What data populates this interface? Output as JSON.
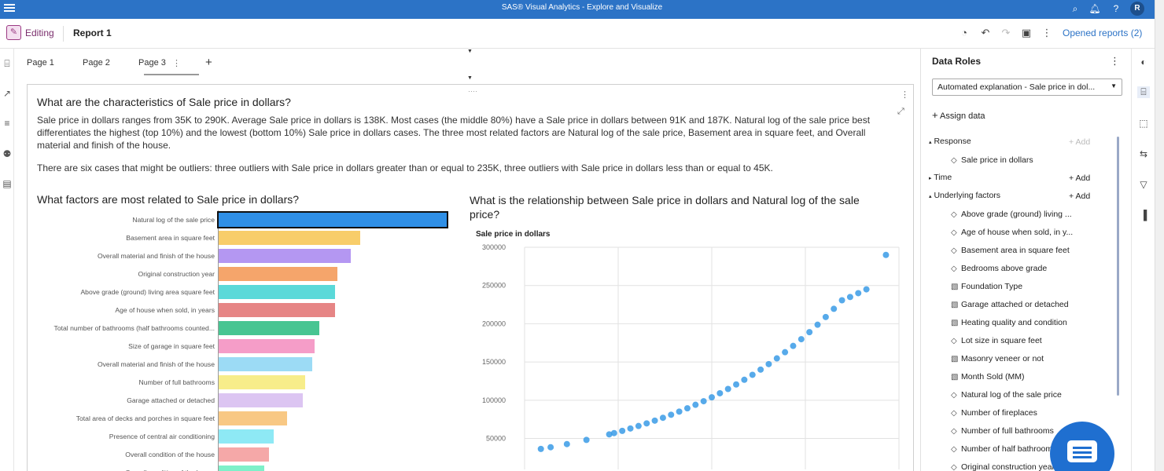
{
  "app": {
    "title": "SAS® Visual Analytics - Explore and Visualize",
    "avatar": "R"
  },
  "toolbar": {
    "mode": "Editing",
    "report_name": "Report 1",
    "opened_reports": "Opened reports (2)"
  },
  "tabs": [
    "Page 1",
    "Page 2",
    "Page 3"
  ],
  "content": {
    "question1": "What are the characteristics of Sale price in dollars?",
    "paragraph1": "Sale price in dollars ranges from 35K to 290K. Average Sale price in dollars is 138K. Most cases (the middle 80%) have a Sale price in dollars between 91K and 187K. Natural log of the sale price best differentiates the highest (top 10%) and the lowest (bottom 10%) Sale price in dollars cases. The three most related factors are Natural log of the sale price, Basement area in square feet, and Overall material and finish of the house.",
    "paragraph2": "There are six cases that might be outliers: three outliers with Sale price in dollars greater than or equal to 235K, three outliers with Sale price in dollars less than or equal to 45K.",
    "question2": "What factors are most related to Sale price in dollars?",
    "question3": "What is the relationship between Sale price in dollars and Natural log of the sale price?"
  },
  "chart_data": [
    {
      "type": "bar",
      "orientation": "horizontal",
      "title": "What factors are most related to Sale price in dollars?",
      "categories": [
        "Natural log of the sale price",
        "Basement area in square feet",
        "Overall material and finish of the house",
        "Original construction year",
        "Above grade (ground) living area square feet",
        "Age of house when sold, in years",
        "Total number of bathrooms (half bathrooms counted...",
        "Size of garage in square feet",
        "Overall material and finish of the house",
        "Number of full bathrooms",
        "Garage attached or detached",
        "Total area of decks and porches in square feet",
        "Presence of central air conditioning",
        "Overall condition of the house",
        "Overall condition of the house"
      ],
      "values": [
        1.0,
        0.62,
        0.58,
        0.52,
        0.51,
        0.51,
        0.44,
        0.42,
        0.41,
        0.38,
        0.37,
        0.3,
        0.24,
        0.22,
        0.2
      ],
      "colors": [
        "#2f8fe6",
        "#f8cd6a",
        "#b497f2",
        "#f5a56b",
        "#5ad9d9",
        "#e68585",
        "#48c592",
        "#f59dc8",
        "#9cdbf5",
        "#f7ed8a",
        "#dcc5f2",
        "#f8c884",
        "#8ee9f5",
        "#f5a8a8",
        "#7ef0c9"
      ],
      "selected_index": 0
    },
    {
      "type": "scatter",
      "title": "What is the relationship between Sale price in dollars and Natural log of the sale price?",
      "ylabel": "Sale price in dollars",
      "ylim": [
        30000,
        300000
      ],
      "yticks": [
        50000,
        100000,
        150000,
        200000,
        250000,
        300000
      ],
      "xlim": [
        10.4,
        12.7
      ],
      "color": "#3a9be6",
      "x": [
        10.5,
        10.56,
        10.66,
        10.78,
        10.92,
        10.95,
        11.0,
        11.05,
        11.1,
        11.15,
        11.2,
        11.25,
        11.3,
        11.35,
        11.4,
        11.45,
        11.5,
        11.55,
        11.6,
        11.65,
        11.7,
        11.75,
        11.8,
        11.85,
        11.9,
        11.95,
        12.0,
        12.05,
        12.1,
        12.15,
        12.2,
        12.25,
        12.3,
        12.35,
        12.4,
        12.45,
        12.5,
        12.62
      ],
      "y": [
        36300,
        38500,
        42600,
        48100,
        55300,
        57000,
        59900,
        63000,
        66300,
        69700,
        73300,
        77000,
        81000,
        85100,
        89400,
        94000,
        98700,
        103800,
        109100,
        114700,
        120600,
        126700,
        133200,
        140000,
        147200,
        154700,
        162800,
        171000,
        179800,
        189000,
        198700,
        208800,
        219500,
        230700,
        235000,
        240000,
        245000,
        290000
      ]
    }
  ],
  "data_roles": {
    "title": "Data Roles",
    "select_value": "Automated explanation - Sale price in dol...",
    "assign": "Assign data",
    "response": "Response",
    "response_item": "Sale price in dollars",
    "time": "Time",
    "underlying": "Underlying factors",
    "add": "Add",
    "items": [
      {
        "label": "Above grade (ground) living ...",
        "icon": "measure"
      },
      {
        "label": "Age of house when sold, in y...",
        "icon": "measure"
      },
      {
        "label": "Basement area in square feet",
        "icon": "measure"
      },
      {
        "label": "Bedrooms above grade",
        "icon": "measure"
      },
      {
        "label": "Foundation Type",
        "icon": "category"
      },
      {
        "label": "Garage attached or detached",
        "icon": "category"
      },
      {
        "label": "Heating quality and condition",
        "icon": "category"
      },
      {
        "label": "Lot size in square feet",
        "icon": "measure"
      },
      {
        "label": "Masonry veneer or not",
        "icon": "category"
      },
      {
        "label": "Month Sold (MM)",
        "icon": "category"
      },
      {
        "label": "Natural log of the sale price",
        "icon": "measure"
      },
      {
        "label": "Number of fireplaces",
        "icon": "measure"
      },
      {
        "label": "Number of full bathrooms",
        "icon": "measure"
      },
      {
        "label": "Number of half bathrooms",
        "icon": "measure"
      },
      {
        "label": "Original construction year",
        "icon": "measure"
      }
    ]
  }
}
